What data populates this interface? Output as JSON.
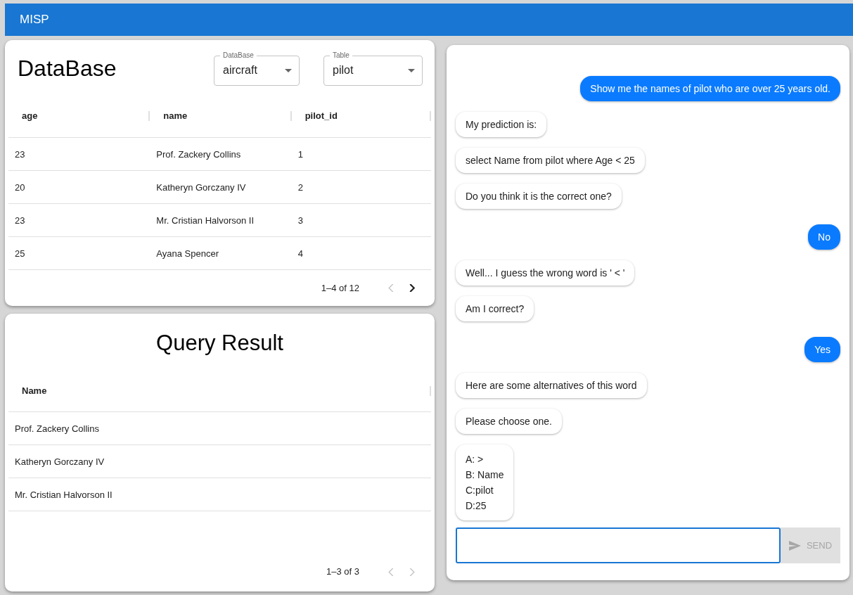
{
  "app_bar": {
    "title": "MISP"
  },
  "database": {
    "title": "DataBase",
    "selects": [
      {
        "label": "DataBase",
        "value": "aircraft"
      },
      {
        "label": "Table",
        "value": "pilot"
      }
    ],
    "table": {
      "columns": [
        "age",
        "name",
        "pilot_id"
      ],
      "rows": [
        [
          "23",
          "Prof. Zackery Collins",
          "1"
        ],
        [
          "20",
          "Katheryn Gorczany IV",
          "2"
        ],
        [
          "23",
          "Mr. Cristian Halvorson II",
          "3"
        ],
        [
          "25",
          "Ayana Spencer",
          "4"
        ]
      ]
    },
    "pagination": {
      "range": "1–4 of 12",
      "prev_disabled": true,
      "next_disabled": false
    }
  },
  "query_result": {
    "title": "Query Result",
    "table": {
      "columns": [
        "Name"
      ],
      "rows": [
        [
          "Prof. Zackery Collins"
        ],
        [
          "Katheryn Gorczany IV"
        ],
        [
          "Mr. Cristian Halvorson II"
        ]
      ]
    },
    "pagination": {
      "range": "1–3 of 3",
      "prev_disabled": true,
      "next_disabled": true
    }
  },
  "chat": {
    "messages": [
      {
        "kind": "user",
        "lines": [
          "Show me the names of pilot who are over 25 years old."
        ]
      },
      {
        "kind": "bot",
        "lines": [
          "My prediction is:"
        ]
      },
      {
        "kind": "bot",
        "lines": [
          "select Name from pilot where Age < 25"
        ]
      },
      {
        "kind": "bot",
        "lines": [
          "Do you think it is the correct one?"
        ]
      },
      {
        "kind": "user",
        "lines": [
          "No"
        ]
      },
      {
        "kind": "bot",
        "lines": [
          "Well... I guess the wrong word is ' < '"
        ]
      },
      {
        "kind": "bot",
        "lines": [
          "Am I correct?"
        ]
      },
      {
        "kind": "user",
        "lines": [
          "Yes"
        ]
      },
      {
        "kind": "bot",
        "lines": [
          "Here are some alternatives of this word"
        ]
      },
      {
        "kind": "bot",
        "lines": [
          "Please choose one."
        ]
      },
      {
        "kind": "bot",
        "lines": [
          "A: >",
          "B: Name",
          "C:pilot",
          "D:25"
        ]
      }
    ],
    "input": {
      "focused": true
    },
    "send_button": {
      "label": "SEND",
      "disabled": true
    }
  }
}
